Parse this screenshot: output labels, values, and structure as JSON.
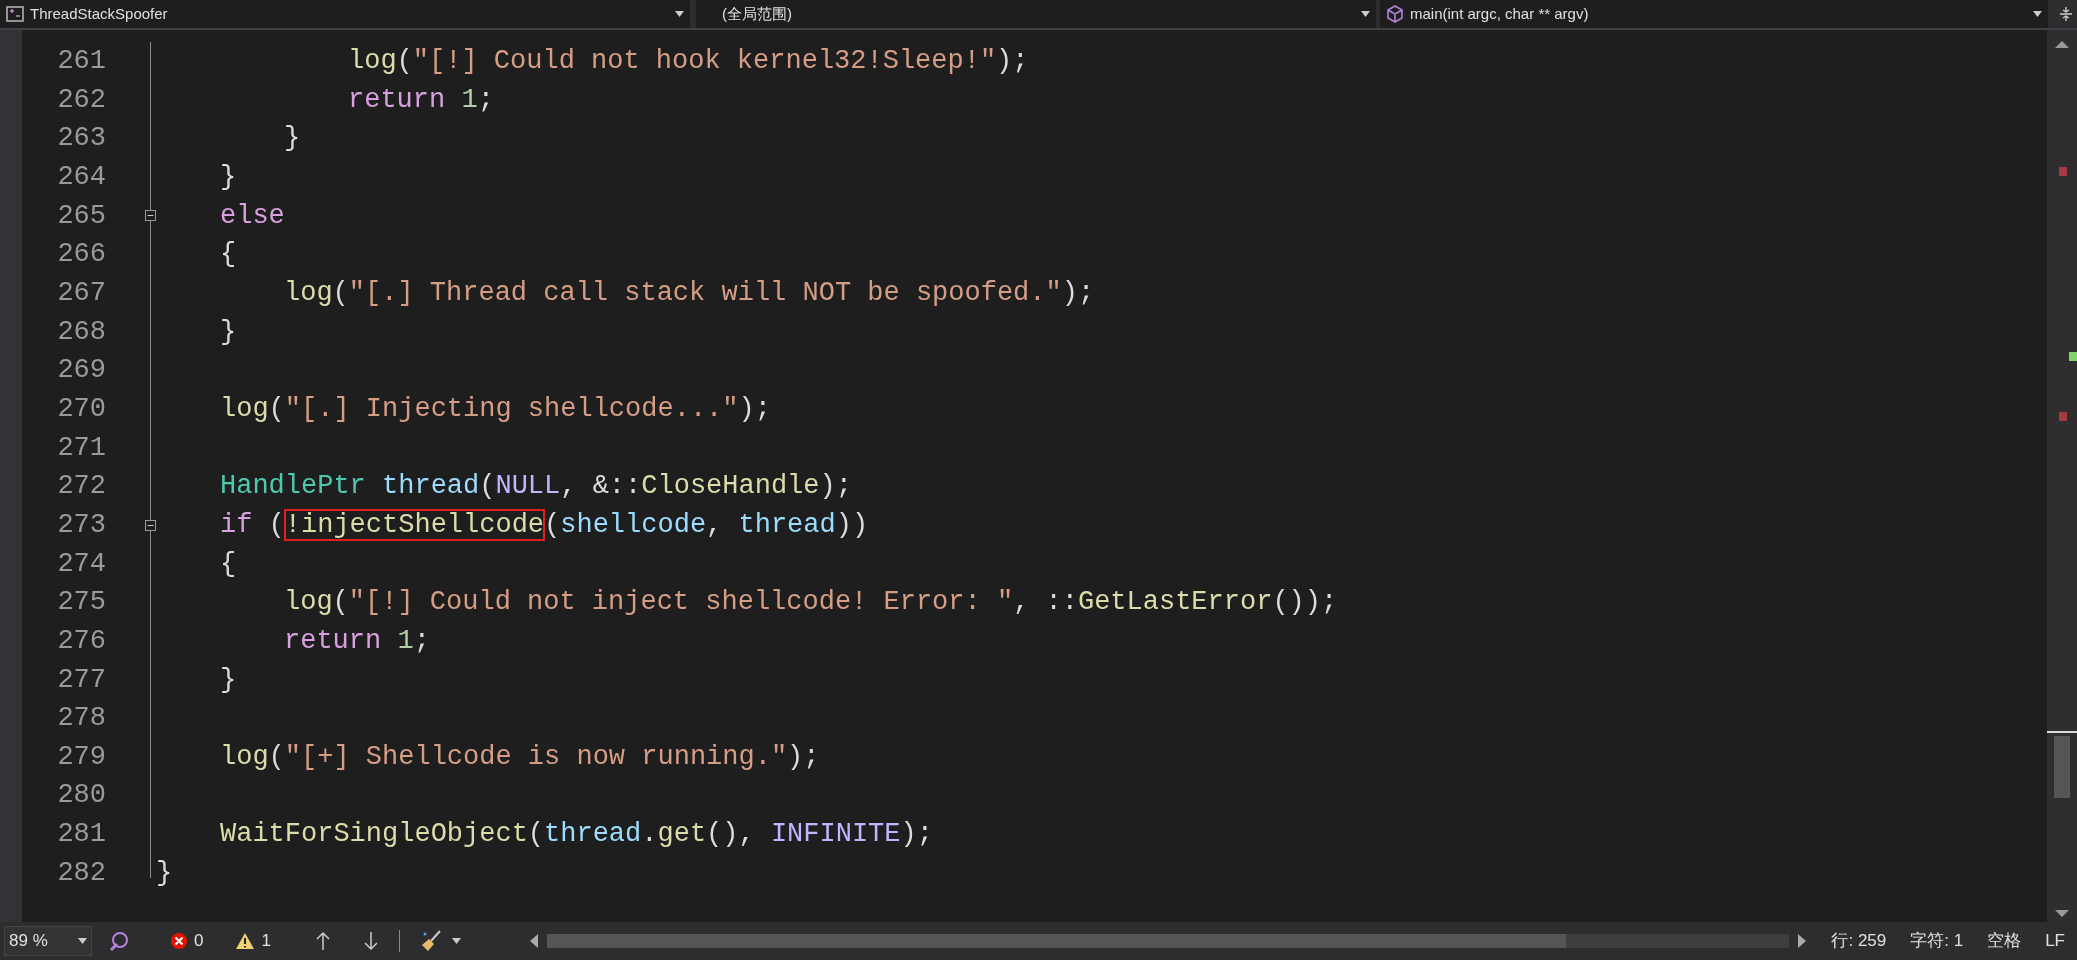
{
  "navbar": {
    "project": "ThreadStackSpoofer",
    "scope": "(全局范围)",
    "member": "main(int argc, char ** argv)"
  },
  "lines": [
    {
      "children": [
        {
          "children": [
            {
              "children": [
                {
                  "number": "261",
                  "tokens": [
                    {
                      "kind": "func",
                      "text": "log"
                    },
                    {
                      "kind": "plain",
                      "text": "("
                    },
                    {
                      "kind": "string",
                      "text": "\"[!] Could not hook kernel32!Sleep!\""
                    },
                    {
                      "kind": "plain",
                      "text": ");"
                    }
                  ]
                },
                {
                  "number": "262",
                  "tokens": [
                    {
                      "kind": "keyword",
                      "text": "return"
                    },
                    {
                      "kind": "number",
                      "text": " 1"
                    },
                    {
                      "kind": "plain",
                      "text": ";"
                    }
                  ]
                }
              ]
            },
            {
              "number": "263",
              "tokens": [
                {
                  "kind": "plain",
                  "text": "}"
                }
              ]
            }
          ]
        },
        {
          "number": "264",
          "tokens": [
            {
              "kind": "plain",
              "text": "}"
            }
          ]
        },
        {
          "number": "265",
          "fold": true,
          "tokens": [
            {
              "kind": "keyword",
              "text": "else"
            }
          ]
        },
        {
          "number": "266",
          "tokens": [
            {
              "kind": "plain",
              "text": "{"
            }
          ],
          "children": [
            {
              "number": "267",
              "tokens": [
                {
                  "kind": "func",
                  "text": "log"
                },
                {
                  "kind": "plain",
                  "text": "("
                },
                {
                  "kind": "string",
                  "text": "\"[.] Thread call stack will NOT be spoofed.\""
                },
                {
                  "kind": "plain",
                  "text": ");"
                }
              ]
            }
          ]
        },
        {
          "number": "268",
          "tokens": [
            {
              "kind": "plain",
              "text": "}"
            }
          ]
        },
        {
          "number": "269"
        },
        {
          "number": "270",
          "tokens": [
            {
              "kind": "func",
              "text": "log"
            },
            {
              "kind": "plain",
              "text": "("
            },
            {
              "kind": "string",
              "text": "\"[.] Injecting shellcode...\""
            },
            {
              "kind": "plain",
              "text": ");"
            }
          ]
        },
        {
          "number": "271"
        },
        {
          "number": "272",
          "tokens": [
            {
              "kind": "type",
              "text": "HandlePtr"
            },
            {
              "kind": "variable",
              "text": " thread"
            },
            {
              "kind": "plain",
              "text": "("
            },
            {
              "kind": "macro",
              "text": "NULL"
            },
            {
              "kind": "plain",
              "text": ", &::"
            },
            {
              "kind": "func",
              "text": "CloseHandle"
            },
            {
              "kind": "plain",
              "text": ");"
            }
          ]
        },
        {
          "number": "273",
          "fold": true,
          "tokens": [
            {
              "kind": "keyword",
              "text": "if"
            },
            {
              "kind": "plain",
              "text": " ("
            },
            {
              "kind": "func",
              "text": "!injectShellcode",
              "boxed": true
            },
            {
              "kind": "plain",
              "text": "("
            },
            {
              "kind": "variable",
              "text": "shellcode"
            },
            {
              "kind": "plain",
              "text": ", "
            },
            {
              "kind": "variable",
              "text": "thread"
            },
            {
              "kind": "plain",
              "text": "))"
            }
          ]
        },
        {
          "number": "274",
          "tokens": [
            {
              "kind": "plain",
              "text": "{"
            }
          ],
          "children": [
            {
              "number": "275",
              "tokens": [
                {
                  "kind": "func",
                  "text": "log"
                },
                {
                  "kind": "plain",
                  "text": "("
                },
                {
                  "kind": "string",
                  "text": "\"[!] Could not inject shellcode! Error: \""
                },
                {
                  "kind": "plain",
                  "text": ", ::"
                },
                {
                  "kind": "func",
                  "text": "GetLastError"
                },
                {
                  "kind": "plain",
                  "text": "());"
                }
              ]
            },
            {
              "number": "276",
              "tokens": [
                {
                  "kind": "keyword",
                  "text": "return"
                },
                {
                  "kind": "number",
                  "text": " 1"
                },
                {
                  "kind": "plain",
                  "text": ";"
                }
              ]
            }
          ]
        },
        {
          "number": "277",
          "tokens": [
            {
              "kind": "plain",
              "text": "}"
            }
          ]
        },
        {
          "number": "278"
        },
        {
          "number": "279",
          "tokens": [
            {
              "kind": "func",
              "text": "log"
            },
            {
              "kind": "plain",
              "text": "("
            },
            {
              "kind": "string",
              "text": "\"[+] Shellcode is now running.\""
            },
            {
              "kind": "plain",
              "text": ");"
            }
          ]
        },
        {
          "number": "280"
        },
        {
          "number": "281",
          "tokens": [
            {
              "kind": "func",
              "text": "WaitForSingleObject"
            },
            {
              "kind": "plain",
              "text": "("
            },
            {
              "kind": "variable",
              "text": "thread"
            },
            {
              "kind": "plain",
              "text": "."
            },
            {
              "kind": "func",
              "text": "get"
            },
            {
              "kind": "plain",
              "text": "(), "
            },
            {
              "kind": "macro",
              "text": "INFINITE"
            },
            {
              "kind": "plain",
              "text": ");"
            }
          ]
        }
      ]
    },
    {
      "number": "282",
      "tokens": [
        {
          "kind": "plain",
          "text": "}"
        }
      ]
    }
  ],
  "status_bar": {
    "zoom": "89 %",
    "errors": "0",
    "warnings": "1",
    "line": "行: 259",
    "column": "字符: 1",
    "indent": "空格",
    "line_ending": "LF"
  }
}
